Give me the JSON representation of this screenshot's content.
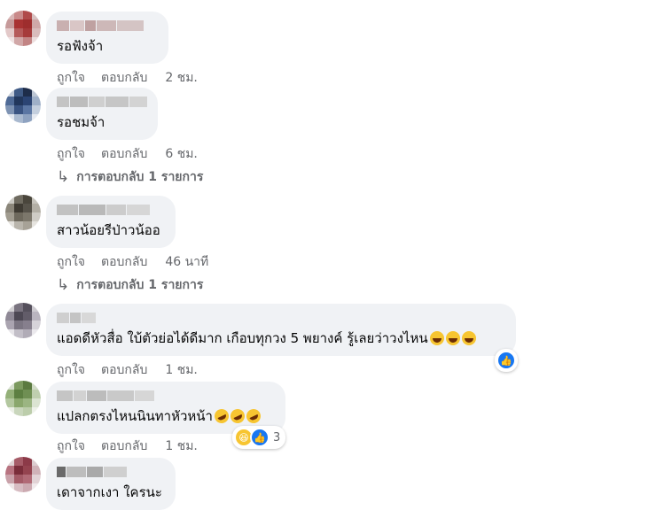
{
  "comments": [
    {
      "text": "รอฟังจ้า",
      "like": "ถูกใจ",
      "reply": "ตอบกลับ",
      "time": "2 ชม."
    },
    {
      "text": "รอชมจ้า",
      "like": "ถูกใจ",
      "reply": "ตอบกลับ",
      "time": "6 ชม.",
      "replies": "การตอบกลับ 1 รายการ"
    },
    {
      "text": "สาวน้อยรีป่าวน้ออ",
      "like": "ถูกใจ",
      "reply": "ตอบกลับ",
      "time": "46 นาที",
      "replies": "การตอบกลับ 1 รายการ"
    },
    {
      "text": "แอดดีหัวสื่อ ใบ้ตัวย่อได้ดีมาก เกือบทุกวง 5 พยางค์ รู้เลยว่าวงไหน",
      "like": "ถูกใจ",
      "reply": "ตอบกลับ",
      "time": "1 ชม."
    },
    {
      "text": "แปลกตรงไหนนินทาหัวหน้า",
      "like": "ถูกใจ",
      "reply": "ตอบกลับ",
      "time": "1 ชม.",
      "reaction_count": "3"
    },
    {
      "text": "เดาจากเงา ใครนะ"
    }
  ],
  "icons": {
    "reply_arrow": "↳",
    "like_reaction": "like-icon",
    "haha_reaction": "haha-icon",
    "grin_emoji": "grinning-sweat-emoji",
    "rofl_emoji": "rofl-emoji"
  },
  "colors": {
    "bubble": "#f0f2f5",
    "meta": "#65676b",
    "like_blue": "#1877f2"
  }
}
